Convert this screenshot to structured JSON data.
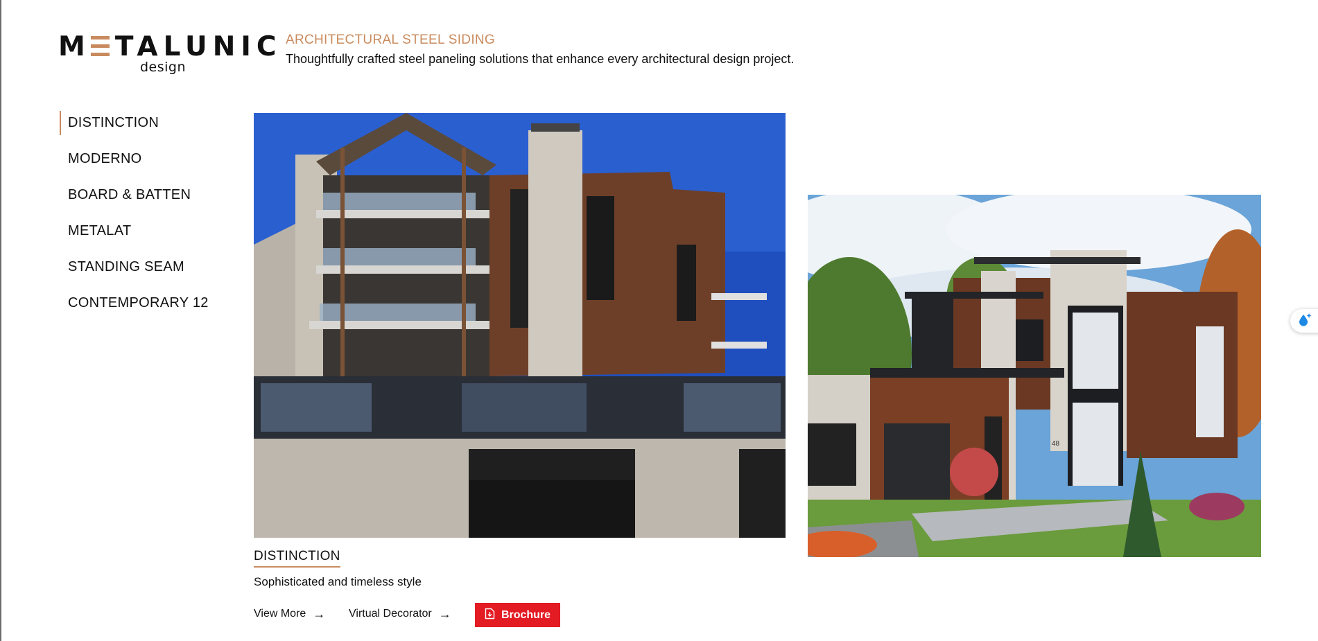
{
  "brand": {
    "logo_word_left": "M",
    "logo_word_right": "TALUNIC",
    "logo_sub": "design"
  },
  "header": {
    "title": "ARCHITECTURAL STEEL SIDING",
    "tagline": "Thoughtfully crafted steel paneling solutions that enhance every architectural design project."
  },
  "sidebar": {
    "items": [
      {
        "label": "DISTINCTION",
        "active": true
      },
      {
        "label": "MODERNO",
        "active": false
      },
      {
        "label": "BOARD & BATTEN",
        "active": false
      },
      {
        "label": "METALAT",
        "active": false
      },
      {
        "label": "STANDING SEAM",
        "active": false
      },
      {
        "label": "CONTEMPORARY 12",
        "active": false
      }
    ]
  },
  "product": {
    "title": "DISTINCTION",
    "description": "Sophisticated and timeless style",
    "actions": {
      "view_more": "View More",
      "virtual_decorator": "Virtual Decorator",
      "brochure": "Brochure"
    },
    "main_image_house_number": "",
    "side_image_house_number": "48"
  },
  "icons": {
    "arrow": "arrow-right-icon",
    "brochure": "download-document-icon",
    "widget": "water-drop-icon"
  },
  "colors": {
    "accent": "#c98b5e",
    "brochure_button": "#e31b23",
    "text": "#111111"
  }
}
